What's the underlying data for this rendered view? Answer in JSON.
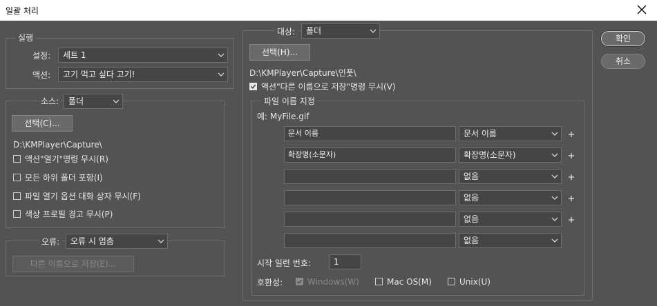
{
  "window": {
    "title": "일괄 처리"
  },
  "execute": {
    "legend": "실행",
    "set_label": "설정:",
    "set_value": "세트 1",
    "action_label": "액션:",
    "action_value": "고기 먹고 싶다 고기!"
  },
  "source": {
    "legend": "소스:",
    "value": "폴더",
    "choose_button": "선택(C)...",
    "path": "D:\\KMPlayer\\Capture\\",
    "options": [
      {
        "label": "액션\"열기\"명령 무시(R)",
        "checked": false
      },
      {
        "label": "모든 하위 폴더 포함(I)",
        "checked": false
      },
      {
        "label": "파일 열기 옵션 대화 상자 무시(F)",
        "checked": false
      },
      {
        "label": "색상 프로필 경고 무시(P)",
        "checked": false
      }
    ]
  },
  "errors": {
    "legend": "오류:",
    "value": "오류 시 멈춤",
    "save_as_button": "다른 이름으로 저장(E)..."
  },
  "destination": {
    "legend": "대상:",
    "value": "폴더",
    "choose_button": "선택(H)...",
    "path": "D:\\KMPlayer\\Capture\\인풋\\",
    "override_label": "액션\"다른 이름으로 저장\"명령 무시(V)",
    "override_checked": true
  },
  "file_naming": {
    "legend": "파일 이름 지정",
    "example": "예: MyFile.gif",
    "rows": [
      {
        "text": "문서 이름",
        "select": "문서 이름",
        "plus": true
      },
      {
        "text": "확장명(소문자)",
        "select": "확장명(소문자)",
        "plus": true
      },
      {
        "text": "",
        "select": "없음",
        "plus": true
      },
      {
        "text": "",
        "select": "없음",
        "plus": true
      },
      {
        "text": "",
        "select": "없음",
        "plus": true
      },
      {
        "text": "",
        "select": "없음",
        "plus": false
      }
    ],
    "serial_label": "시작 일련 번호:",
    "serial_value": "1",
    "compat_label": "호환성:",
    "compat": [
      {
        "label": "Windows(W)",
        "checked": true,
        "disabled": true
      },
      {
        "label": "Mac OS(M)",
        "checked": false,
        "disabled": false
      },
      {
        "label": "Unix(U)",
        "checked": false,
        "disabled": false
      }
    ]
  },
  "buttons": {
    "ok": "확인",
    "cancel": "취소"
  }
}
